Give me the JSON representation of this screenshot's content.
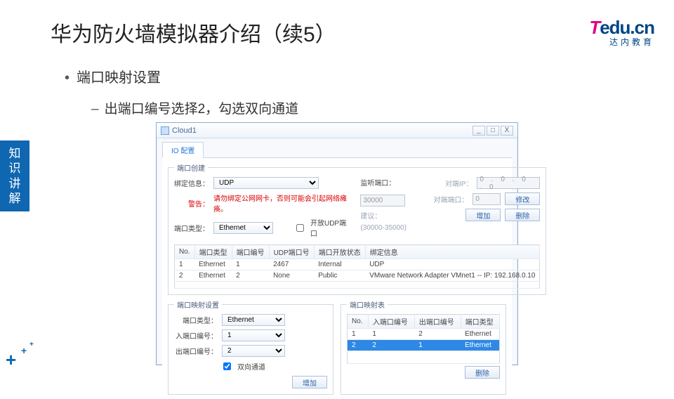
{
  "slide": {
    "title": "华为防火墙模拟器介绍（续5）",
    "bullet1": "端口映射设置",
    "bullet2": "出端口编号选择2，勾选双向通道",
    "side_tag": [
      "知",
      "识",
      "讲",
      "解"
    ],
    "logo_text": "edu.cn",
    "logo_T": "T",
    "logo_sub": "达内教育"
  },
  "window": {
    "title": "Cloud1",
    "min": "_",
    "max": "□",
    "close": "X",
    "tab": "IO 配置"
  },
  "port_create": {
    "legend": "端口创建",
    "bind_label": "绑定信息：",
    "bind_value": "UDP",
    "warn_label": "警告：",
    "warn_text": "请勿绑定公网网卡，否则可能会引起网络瘫痪。",
    "type_label": "端口类型：",
    "type_value": "Ethernet",
    "open_udp_label": "开放UDP端口",
    "listen_label": "监听端口：",
    "listen_value": "30000",
    "range_label": "建议：",
    "range_value": "(30000-35000)",
    "peer_ip_label": "对端IP：",
    "peer_ip_value": "0 . 0 . 0 . 0",
    "peer_port_label": "对端端口：",
    "peer_port_value": "0",
    "btn_mod": "修改",
    "btn_add": "增加",
    "btn_del": "删除",
    "table": {
      "headers": [
        "No.",
        "端口类型",
        "端口编号",
        "UDP端口号",
        "端口开放状态",
        "绑定信息"
      ],
      "rows": [
        [
          "1",
          "Ethernet",
          "1",
          "2467",
          "Internal",
          "UDP"
        ],
        [
          "2",
          "Ethernet",
          "2",
          "None",
          "Public",
          "VMware Network Adapter VMnet1 -- IP: 192.168.0.10"
        ]
      ]
    }
  },
  "port_map_set": {
    "legend": "端口映射设置",
    "type_label": "端口类型：",
    "type_value": "Ethernet",
    "in_label": "入端口编号：",
    "in_value": "1",
    "out_label": "出端口编号：",
    "out_value": "2",
    "bi_label": "双向通道",
    "btn_add": "增加"
  },
  "port_map_tbl": {
    "legend": "端口映射表",
    "headers": [
      "No.",
      "入端口编号",
      "出端口编号",
      "端口类型"
    ],
    "rows": [
      {
        "cells": [
          "1",
          "1",
          "2",
          "Ethernet"
        ],
        "selected": false
      },
      {
        "cells": [
          "2",
          "2",
          "1",
          "Ethernet"
        ],
        "selected": true
      }
    ],
    "btn_del": "删除"
  }
}
